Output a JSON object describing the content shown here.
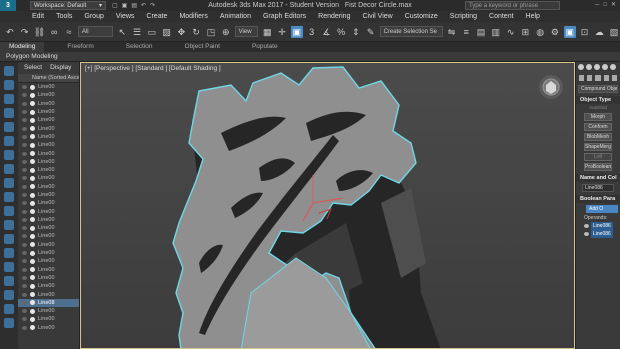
{
  "title_bar": {
    "app_icon_label": "3",
    "workspace_label": "Workspace: Default",
    "window_title": "Autodesk 3ds Max 2017 - Student Version",
    "file_name": "Fist Decor Circle.max",
    "search_placeholder": "Type a keyword or phrase"
  },
  "menu": [
    "Edit",
    "Tools",
    "Group",
    "Views",
    "Create",
    "Modifiers",
    "Animation",
    "Graph Editors",
    "Rendering",
    "Civil View",
    "Customize",
    "Scripting",
    "Content",
    "Help"
  ],
  "toolbar": {
    "selection_filter": "All",
    "reference_coord": "View",
    "selection_set": "Create Selection Se"
  },
  "ribbon_tabs": [
    "Modeling",
    "Freeform",
    "Selection",
    "Object Paint",
    "Populate"
  ],
  "sub_ribbon_label": "Polygon Modeling",
  "scene_explorer": {
    "menu": [
      "Select",
      "Display"
    ],
    "column_header": "Name (Sorted Ascen",
    "rows": [
      "Line00",
      "Line00",
      "Line00",
      "Line00",
      "Line00",
      "Line00",
      "Line00",
      "Line00",
      "Line00",
      "Line00",
      "Line00",
      "Line00",
      "Line00",
      "Line00",
      "Line00",
      "Line00",
      "Line00",
      "Line00",
      "Line00",
      "Line00",
      "Line00",
      "Line00",
      "Line00",
      "Line00",
      "Line00",
      "Line00",
      "Line00",
      "Line00",
      "Line00",
      "Line00",
      "Line00"
    ],
    "selected_row": "Line08"
  },
  "viewport": {
    "label": "[+] [Perspective ] [Standard ] [Default Shading ]"
  },
  "command_panel": {
    "category_dropdown": "Compound Objects",
    "object_type_title": "Object Type",
    "autogrid_label": "AutoGrid",
    "buttons": [
      "Morph",
      "Conform",
      "BlobMesh",
      "ShapeMerge",
      "Loft",
      "ProBoolean"
    ],
    "name_color_title": "Name and Col",
    "name_value": "Line086",
    "boolean_title": "Boolean Para",
    "add_label": "Add O",
    "operands_label": "Operands:",
    "operands": [
      "Line086",
      "Line086"
    ]
  },
  "colors": {
    "accent": "#4a86c4",
    "viewport_border": "#d9c28a",
    "selection_outline": "#6fd7e6"
  }
}
